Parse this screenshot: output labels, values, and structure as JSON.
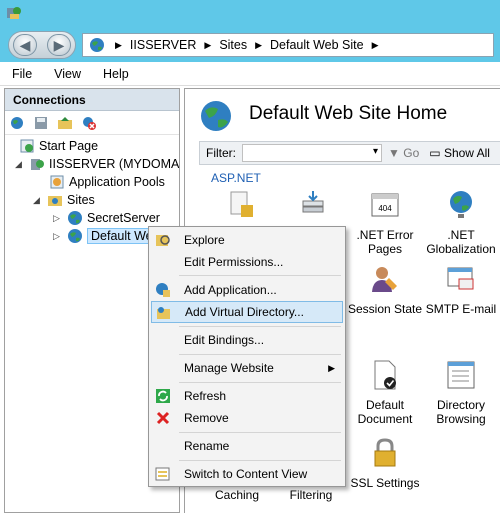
{
  "address": {
    "crumbs": [
      "IISSERVER",
      "Sites",
      "Default Web Site"
    ]
  },
  "menubar": {
    "file": "File",
    "view": "View",
    "help": "Help"
  },
  "connections": {
    "title": "Connections",
    "tree": {
      "start_page": "Start Page",
      "server": "IISSERVER (MYDOMAIN\\",
      "app_pools": "Application Pools",
      "sites": "Sites",
      "secret_server": "SecretServer",
      "default_site": "Default Web"
    }
  },
  "main": {
    "title": "Default Web Site Home",
    "filter_label": "Filter:",
    "go_label": "Go",
    "show_all_label": "Show All",
    "section_aspnet": "ASP.NET",
    "features": {
      "net_error_pages_l1": ".NET Error",
      "net_error_pages_l2": "Pages",
      "net_glob_l1": ".NET",
      "net_glob_l2": "Globalization",
      "session_state": "Session State",
      "smtp_email": "SMTP E-mail",
      "default_doc_l1": "Default",
      "default_doc_l2": "Document",
      "dir_browse_l1": "Directory",
      "dir_browse_l2": "Browsing",
      "ssl_settings": "SSL Settings",
      "caching": "Caching",
      "filtering": "Filtering"
    }
  },
  "context_menu": {
    "explore": "Explore",
    "edit_permissions": "Edit Permissions...",
    "add_application": "Add Application...",
    "add_virtual_directory": "Add Virtual Directory...",
    "edit_bindings": "Edit Bindings...",
    "manage_website": "Manage Website",
    "refresh": "Refresh",
    "remove": "Remove",
    "rename": "Rename",
    "switch_content_view": "Switch to Content View"
  }
}
